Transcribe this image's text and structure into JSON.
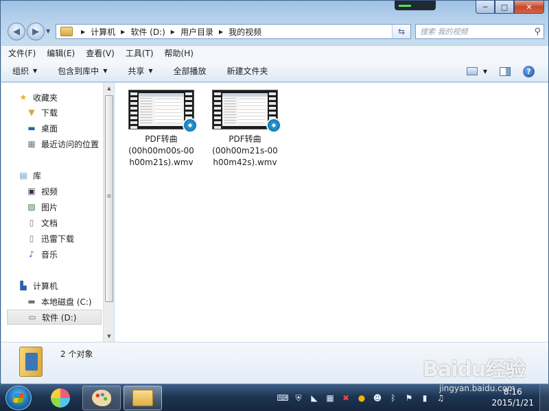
{
  "window": {
    "buttons": {
      "minimize": "─",
      "maximize": "□",
      "close": "✕"
    }
  },
  "address": {
    "crumbs": [
      "计算机",
      "软件 (D:)",
      "用户目录",
      "我的视频"
    ],
    "search_placeholder": "搜索 我的视频"
  },
  "menu": [
    "文件(F)",
    "编辑(E)",
    "查看(V)",
    "工具(T)",
    "帮助(H)"
  ],
  "commands": {
    "organize": "组织",
    "include": "包含到库中",
    "share": "共享",
    "play_all": "全部播放",
    "new_folder": "新建文件夹"
  },
  "nav": {
    "favorites": "收藏夹",
    "downloads": "下载",
    "desktop": "桌面",
    "recent": "最近访问的位置",
    "libraries": "库",
    "videos": "视频",
    "pictures": "图片",
    "documents": "文档",
    "thunder": "迅雷下载",
    "music": "音乐",
    "computer": "计算机",
    "drive_c": "本地磁盘 (C:)",
    "drive_d": "软件 (D:)"
  },
  "files": [
    {
      "line1": "PDF转曲",
      "line2": "(00h00m00s-00",
      "line3": "h00m21s).wmv"
    },
    {
      "line1": "PDF转曲",
      "line2": "(00h00m21s-00",
      "line3": "h00m42s).wmv"
    }
  ],
  "details": {
    "count": "2 个对象"
  },
  "taskbar": {
    "time": "8:16",
    "date": "2015/1/21"
  },
  "watermark": {
    "logo": "Baidu经验",
    "url": "jingyan.baidu.com"
  }
}
